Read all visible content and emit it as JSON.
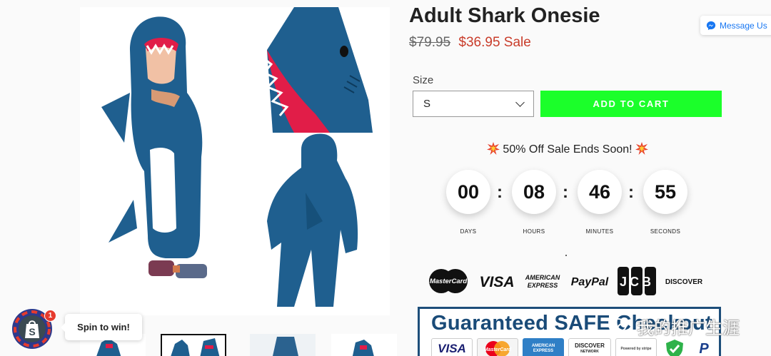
{
  "product": {
    "title": "Adult Shark Onesie",
    "old_price": "$79.95",
    "sale_price": "$36.95 Sale",
    "image_icon": "shark-onesie-photo"
  },
  "options": {
    "size_label": "Size",
    "size_value": "S"
  },
  "cart": {
    "add_label": "ADD TO CART"
  },
  "promo": {
    "banner_text": "50% Off Sale Ends Soon!",
    "emoji_icon": "collision-emoji-icon"
  },
  "countdown": {
    "days": "00",
    "hours": "08",
    "minutes": "46",
    "seconds": "55",
    "days_label": "DAYS",
    "hours_label": "HOURS",
    "minutes_label": "MINUTES",
    "seconds_label": "SECONDS",
    "separator": ":"
  },
  "payments": {
    "mastercard": "MasterCard",
    "visa": "VISA",
    "amex_line1": "AMERICAN",
    "amex_line2": "EXPRESS",
    "paypal": "PayPal",
    "jcb": "JCB",
    "discover": "DISCOVER"
  },
  "guarantee": {
    "title": "Guaranteed SAFE Checkout",
    "badges": {
      "visa": "VISA",
      "mastercard": "MasterCard",
      "amex": "AMERICAN EXPRESS",
      "discover": "DISCOVER",
      "discover_sub": "NETWORK",
      "stripe": "Powered by stripe",
      "paypal": "P"
    }
  },
  "messenger": {
    "label": "Message Us"
  },
  "spin": {
    "label": "Spin to win!",
    "badge_count": "1"
  },
  "watermark": {
    "text": "我的推广生涯"
  },
  "colors": {
    "sale_red": "#c93c2a",
    "cart_green": "#1bff2a",
    "guarantee_blue": "#1a4b78",
    "messenger_blue": "#1877f2",
    "shark_blue": "#1f5f8f"
  }
}
